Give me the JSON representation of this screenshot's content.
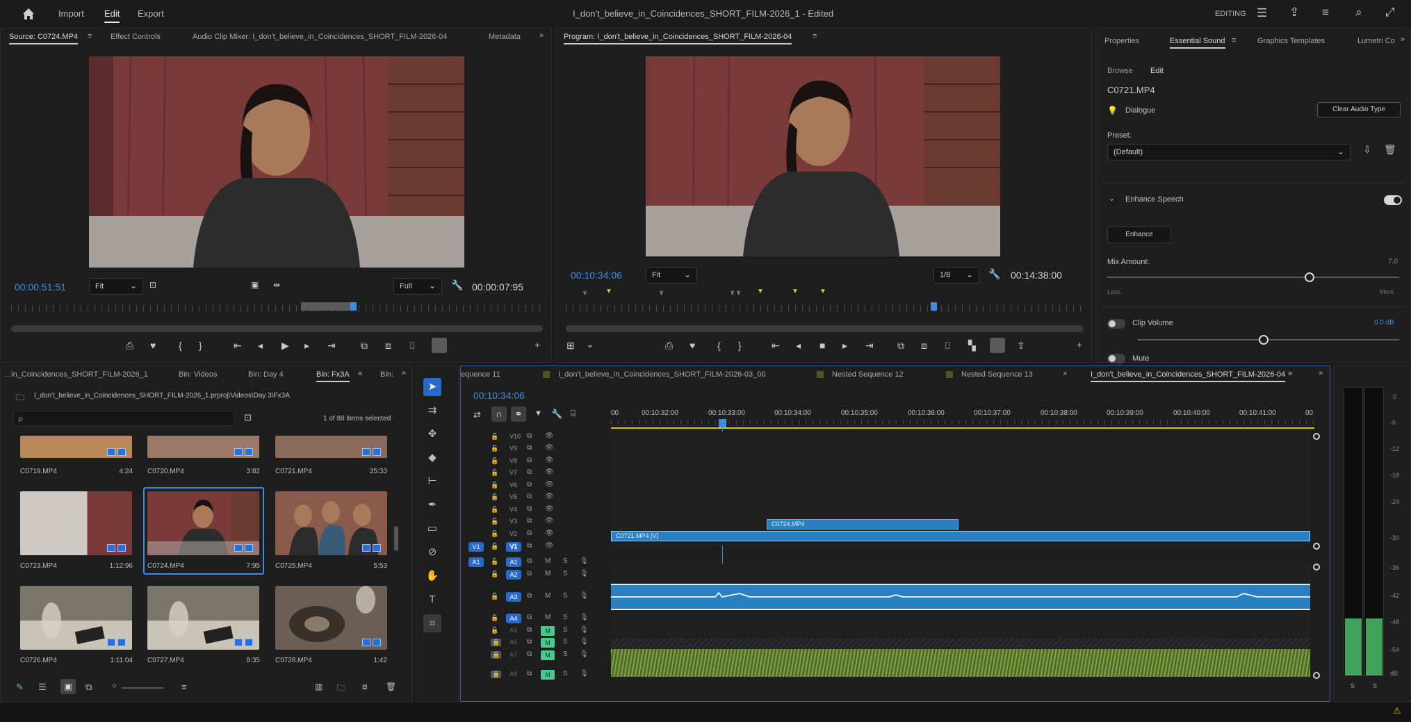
{
  "menubar": {
    "import": "Import",
    "edit": "Edit",
    "export": "Export",
    "title": "I_don't_believe_in_Coincidences_SHORT_FILM-2026_1 - Edited",
    "workspace": "EDITING"
  },
  "source": {
    "tabs": [
      "Source: C0724.MP4",
      "Effect Controls",
      "Audio Clip Mixer: I_don't_believe_in_Coincidences_SHORT_FILM-2026-04",
      "Metadata"
    ],
    "timecode": "00:00:51:51",
    "zoom": "Fit",
    "resolution": "Full",
    "duration": "00:00:07:95"
  },
  "program": {
    "tab": "Program: I_don't_believe_in_Coincidences_SHORT_FILM-2026-04",
    "timecode": "00:10:34:06",
    "zoom": "Fit",
    "resolution": "1/8",
    "duration": "00:14:38:00"
  },
  "essential": {
    "tabs": [
      "Properties",
      "Essential Sound",
      "Graphics Templates",
      "Lumetri Co"
    ],
    "subtabs": [
      "Browse",
      "Edit"
    ],
    "clip": "C0721.MP4",
    "type": "Dialogue",
    "clear_btn": "Clear Audio Type",
    "preset_label": "Preset:",
    "preset_value": "(Default)",
    "enhance_section": "Enhance Speech",
    "enhance_btn": "Enhance",
    "mix_label": "Mix Amount:",
    "mix_value": "7.0",
    "less": "Less",
    "more": "More",
    "clip_volume": "Clip Volume",
    "clip_volume_value": "0.0 dB",
    "mute": "Mute"
  },
  "project": {
    "tabs": [
      "...in_Coincidences_SHORT_FILM-2026_1",
      "Bin: Videos",
      "Bin: Day 4",
      "Bin: Fx3A",
      "Bin:"
    ],
    "path": "I_don't_believe_in_Coincidences_SHORT_FILM-2026_1.prproj\\Videos\\Day 3\\Fx3A",
    "count": "1 of 88 items selected",
    "items": [
      {
        "name": "C0719.MP4",
        "dur": "4:24"
      },
      {
        "name": "C0720.MP4",
        "dur": "3:82"
      },
      {
        "name": "C0721.MP4",
        "dur": "25:33"
      },
      {
        "name": "C0723.MP4",
        "dur": "1:12:96"
      },
      {
        "name": "C0724.MP4",
        "dur": "7:95"
      },
      {
        "name": "C0725.MP4",
        "dur": "5:53"
      },
      {
        "name": "C0726.MP4",
        "dur": "1:11:04"
      },
      {
        "name": "C0727.MP4",
        "dur": "8:35"
      },
      {
        "name": "C0728.MP4",
        "dur": "1:42"
      }
    ]
  },
  "timeline": {
    "tabs": [
      "equence 11",
      "I_don't_believe_in_Coincidences_SHORT_FILM-2026-03_00",
      "Nested Sequence 12",
      "Nested Sequence 13",
      "I_don't_believe_in_Coincidences_SHORT_FILM-2026-04"
    ],
    "timecode": "00:10:34:06",
    "ruler": [
      "00",
      "00:10:32:00",
      "00:10:33:00",
      "00:10:34:00",
      "00:10:35:00",
      "00:10:36:00",
      "00:10:37:00",
      "00:10:38:00",
      "00:10:39:00",
      "00:10:40:00",
      "00:10:41:00",
      "00"
    ],
    "video_tracks": [
      "V10",
      "V9",
      "V8",
      "V7",
      "V6",
      "V5",
      "V4",
      "V3",
      "V2",
      "V1"
    ],
    "audio_tracks": [
      "A1",
      "A2",
      "A3",
      "A4",
      "A5",
      "A6",
      "A7",
      "A8"
    ],
    "clip_v3": "C0724.MP4",
    "clip_v2": "C0721.MP4 [V]",
    "src_v1": "V1",
    "src_a1": "A1",
    "m": "M",
    "s": "S"
  },
  "meter": {
    "scale": [
      "0",
      "-6",
      "-12",
      "-18",
      "-24",
      "-30",
      "-36",
      "-42",
      "-48",
      "-54",
      "dB"
    ],
    "channels": [
      "S",
      "S"
    ]
  },
  "colors": {
    "accent_blue": "#3f8de0",
    "audio_green": "#4ac98f",
    "clip_blue": "#2a7fc0"
  }
}
